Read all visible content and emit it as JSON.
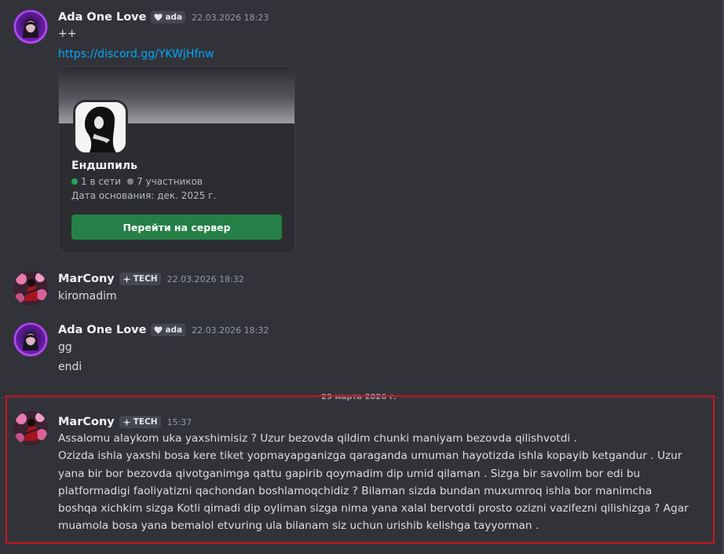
{
  "messages": [
    {
      "author": "Ada One Love",
      "tag": "ada",
      "timestamp": "22.03.2026 18:23",
      "lines": [
        "++"
      ],
      "link": "https://discord.gg/YKWjHfnw",
      "invite": {
        "server_name": "Ендшпиль",
        "online": "1 в сети",
        "members": "7 участников",
        "founded": "Дата основания: дек. 2025 г.",
        "button": "Перейти на сервер"
      }
    },
    {
      "author": "MarCony",
      "tag": "TECH",
      "timestamp": "22.03.2026 18:32",
      "lines": [
        "kiromadim"
      ]
    },
    {
      "author": "Ada One Love",
      "tag": "ada",
      "timestamp": "22.03.2026 18:32",
      "lines": [
        "gg",
        "endi"
      ]
    },
    {
      "author": "MarCony",
      "tag": "TECH",
      "timestamp": "15:37",
      "lines": [
        "Assalomu alaykom uka yaxshimisiz  ?  Uzur bezovda qildim chunki maniyam bezovda qilishvotdi .",
        "Ozizda ishla yaxshi bosa kere tiket yopmayapganizga qaraganda umuman hayotizda ishla kopayib ketgandur . Uzur",
        "yana bir bor bezovda qivotganimga qattu gapirib qoymadim dip umid qilaman . Sizga bir savolim bor edi bu",
        "platformadigi faoliyatizni qachondan boshlamoqchidiz  ? Bilaman sizda bundan muxumroq ishla bor manimcha",
        "boshqa xichkim sizga Kotli qimadi dip oyliman sizga nima yana xalal bervotdi prosto ozizni vazifezni qilishizga  ?  Agar",
        "muamola bosa yana bemalol etvuring ula bilanam siz uchun urishib kelishga tayyorman ."
      ]
    }
  ],
  "date_divider": "29 марта 2026 г.",
  "colors": {
    "background": "#323339",
    "link": "#00a8fc",
    "online_dot": "#23a559",
    "members_dot": "#80848e",
    "join_button": "#248046",
    "highlight_border": "#c8161d"
  }
}
